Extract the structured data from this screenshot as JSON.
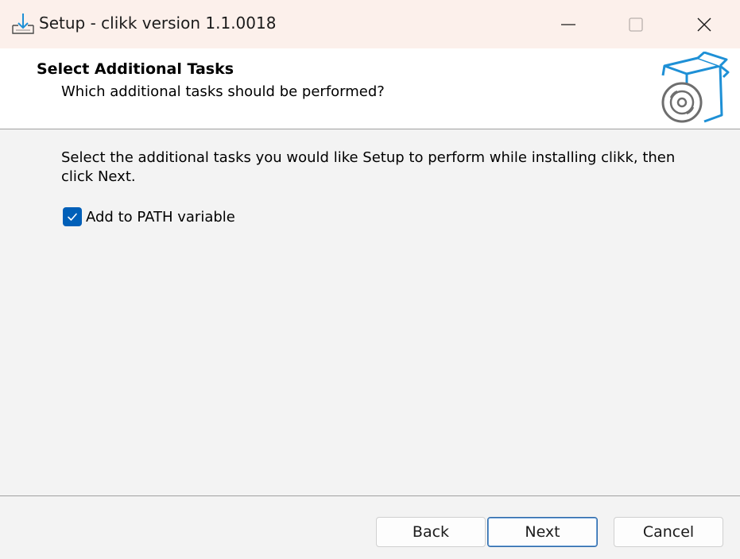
{
  "window": {
    "title": "Setup - clikk version 1.1.0018",
    "app_icon": "installer-download-icon",
    "controls": {
      "minimize_icon": "minimize-icon",
      "maximize_icon": "maximize-icon",
      "close_icon": "close-icon"
    }
  },
  "header": {
    "title": "Select Additional Tasks",
    "subtitle": "Which additional tasks should be performed?",
    "icon": "package-disc-icon"
  },
  "body": {
    "instructions": "Select the additional tasks you would like Setup to perform while installing clikk, then click Next."
  },
  "tasks": [
    {
      "label": "Add to PATH variable",
      "checked": true
    }
  ],
  "buttons": {
    "back": "Back",
    "next": "Next",
    "cancel": "Cancel"
  },
  "colors": {
    "titlebar_bg": "#fcf0eb",
    "accent": "#005fb8",
    "dialog_bg": "#f3f3f3",
    "icon_blue": "#1e90d6"
  }
}
